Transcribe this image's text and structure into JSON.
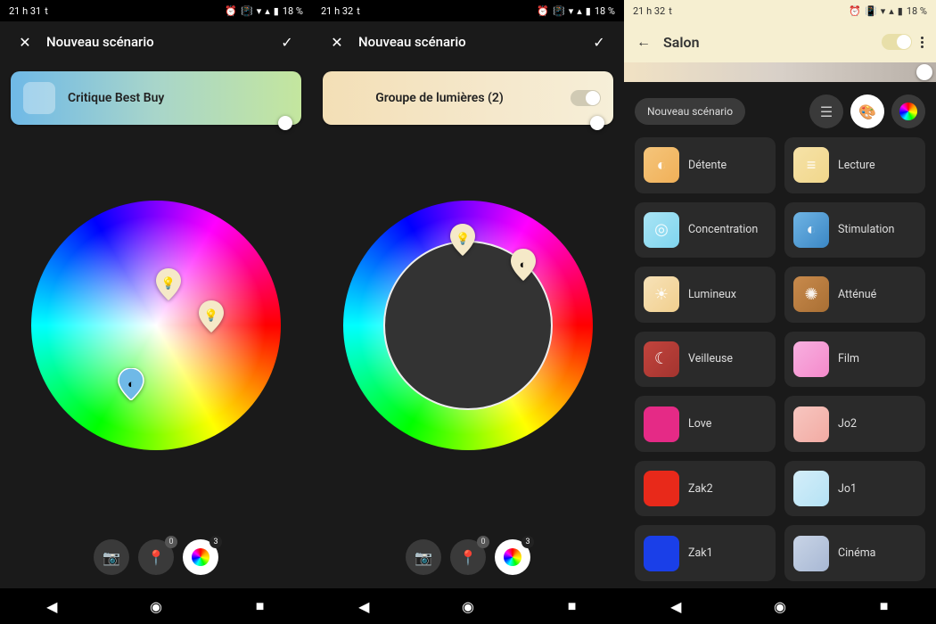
{
  "panels": {
    "p1": {
      "time": "21 h 31",
      "tag": "t",
      "battery": "18 %",
      "title": "Nouveau scénario",
      "room_name": "Critique Best Buy",
      "tab_badge_pin": "0",
      "tab_badge_color": "3"
    },
    "p2": {
      "time": "21 h 32",
      "tag": "t",
      "battery": "18 %",
      "title": "Nouveau scénario",
      "group_label": "Groupe de lumières (2)",
      "tab_badge_pin": "0",
      "tab_badge_color": "3"
    },
    "p3": {
      "time": "21 h 32",
      "tag": "t",
      "battery": "18 %",
      "room": "Salon",
      "new_scene_btn": "Nouveau scénario",
      "scenes": {
        "s0": "Détente",
        "s1": "Lecture",
        "s2": "Concentration",
        "s3": "Stimulation",
        "s4": "Lumineux",
        "s5": "Atténué",
        "s6": "Veilleuse",
        "s7": "Film",
        "s8": "Love",
        "s9": "Jo2",
        "s10": "Zak2",
        "s11": "Jo1",
        "s12": "Zak1",
        "s13": "Cinéma"
      }
    }
  },
  "colors": {
    "scenes": {
      "s0": "linear-gradient(135deg,#f5c57b,#f0b058)",
      "s1": "linear-gradient(135deg,#f6e2a8,#f1d78b)",
      "s2": "linear-gradient(135deg,#a9e4f5,#7fd5ee)",
      "s3": "linear-gradient(135deg,#6fb4e4,#3b87c5)",
      "s4": "linear-gradient(135deg,#f7e2b8,#f1cf8e)",
      "s5": "linear-gradient(135deg,#c88a4c,#a96f34)",
      "s6": "linear-gradient(135deg,#c2443d,#a3342f)",
      "s7": "linear-gradient(135deg,#f8b0e0,#f48acb)",
      "s8": "#e52a86",
      "s9": "linear-gradient(135deg,#f7c6c0,#f2aba3)",
      "s10": "#e8291a",
      "s11": "linear-gradient(135deg,#d4eef9,#b5e2f5)",
      "s12": "#1a3fe8",
      "s13": "linear-gradient(135deg,#c8d4e6,#a8b8d4)"
    }
  }
}
